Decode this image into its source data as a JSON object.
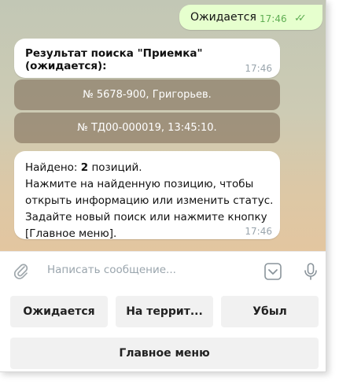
{
  "messages": {
    "outgoing": {
      "text": "Ожидается",
      "time": "17:46",
      "status_icon": "double-check-icon"
    },
    "result_header": {
      "text": "Результат поиска \"Приемка\" (ожидается):",
      "time": "17:46"
    },
    "inline_buttons": [
      {
        "label": "№ 5678-900, Григорьев."
      },
      {
        "label": "№ ТД00-000019, 13:45:10."
      }
    ],
    "result_info": {
      "line1_prefix": "Найдено: ",
      "line1_count": "2",
      "line1_suffix": " позиций.",
      "line2": "Нажмите на найденную позицию, чтобы открыть информацию или изменить статус.",
      "line3": "Задайте новый поиск или нажмите кнопку [Главное меню].",
      "time": "17:46"
    }
  },
  "composer": {
    "placeholder": "Написать сообщение...",
    "icons": [
      "paperclip-icon",
      "keyboard-toggle-icon",
      "microphone-icon"
    ]
  },
  "reply_keyboard": {
    "row1": [
      "Ожидается",
      "На террит...",
      "Убыл"
    ],
    "row2": [
      "Главное меню"
    ]
  },
  "colors": {
    "outgoing_bubble": "#e6ffce",
    "outgoing_time": "#5fae53",
    "inline_button": "#8a7a66"
  }
}
